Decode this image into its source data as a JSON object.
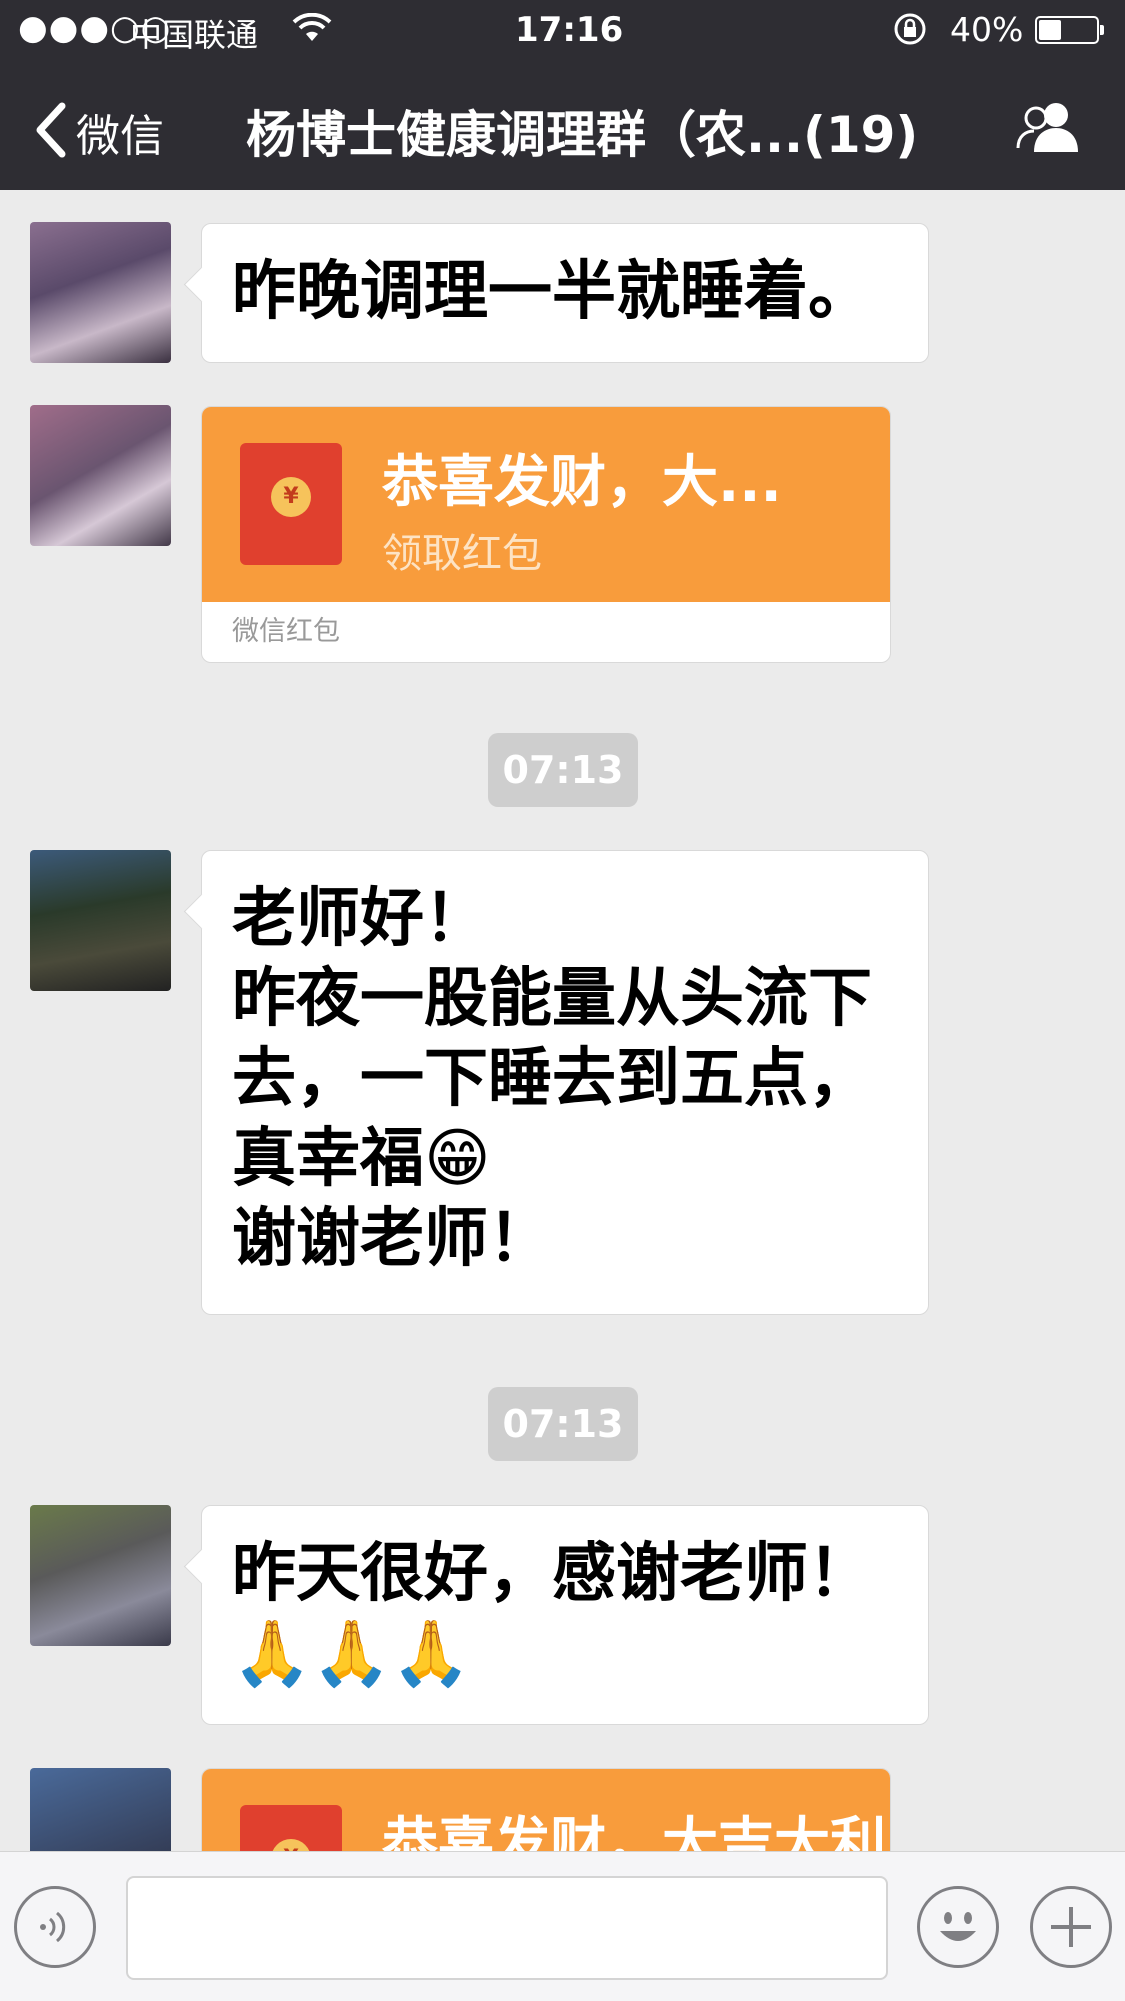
{
  "status_bar": {
    "signal": "●●●○○",
    "carrier": "中国联通",
    "time": "17:16",
    "battery_percent": "40%",
    "battery_level": 0.4
  },
  "nav": {
    "back_label": "微信",
    "title": "杨博士健康调理群（农...(19)",
    "icons": [
      "chevron-left-icon",
      "group-members-icon"
    ]
  },
  "messages": [
    {
      "type": "text",
      "lines": [
        "昨晚调理一半就睡着。"
      ]
    },
    {
      "type": "red_packet",
      "title": "恭喜发财，大...",
      "subtitle": "领取红包",
      "footer": "微信红包"
    },
    {
      "type": "timestamp",
      "text": "07:13"
    },
    {
      "type": "text",
      "lines": [
        "老师好！",
        "昨夜一股能量从头流下",
        "去，一下睡去到五点，",
        "真幸福😁",
        "谢谢老师！"
      ]
    },
    {
      "type": "timestamp",
      "text": "07:13"
    },
    {
      "type": "text",
      "lines": [
        "昨天很好，感谢老师！",
        "🙏🙏🙏"
      ]
    },
    {
      "type": "red_packet",
      "title": "恭喜发财，大吉大利",
      "subtitle": "",
      "footer": ""
    }
  ],
  "input_bar": {
    "placeholder": "",
    "icons": [
      "voice-icon",
      "emoji-icon",
      "plus-icon"
    ]
  },
  "colors": {
    "nav_bg": "#2e2d33",
    "chat_bg": "#ebebeb",
    "red_packet_orange": "#f89c3c",
    "envelope_red": "#e0402e"
  }
}
